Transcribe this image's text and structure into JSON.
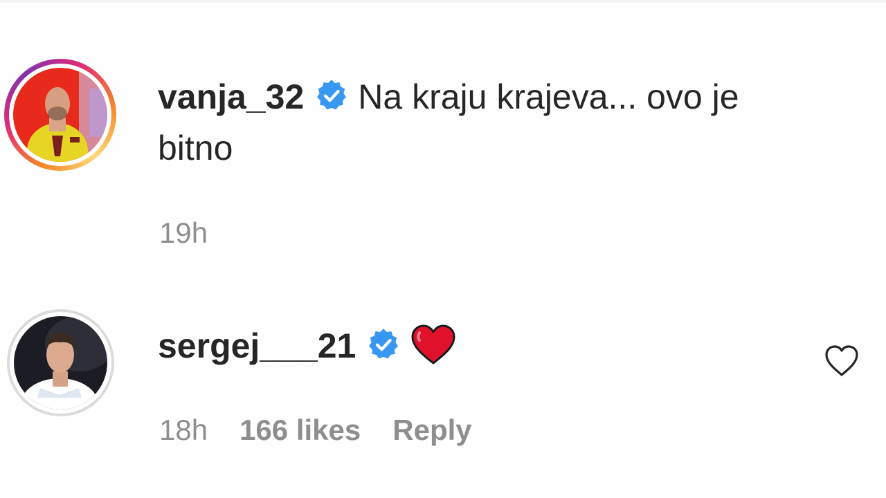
{
  "comments": [
    {
      "username": "vanja_32",
      "verified": true,
      "avatar_icon": "goalkeeper-avatar",
      "story_ring": true,
      "text_line1": "Na kraju krajeva... ovo je",
      "text_line2": "bitno",
      "time": "19h"
    },
    {
      "username": "sergej___21",
      "verified": true,
      "avatar_icon": "player-avatar",
      "story_ring": false,
      "text_emoji": "red-heart-emoji",
      "time": "18h",
      "likes": "166 likes",
      "reply_label": "Reply",
      "like_icon": "heart-outline-icon"
    }
  ],
  "colors": {
    "verified_blue": "#3897f0",
    "meta_gray": "#8e8e8e",
    "text": "#262626",
    "heart_red": "#e0122b"
  }
}
